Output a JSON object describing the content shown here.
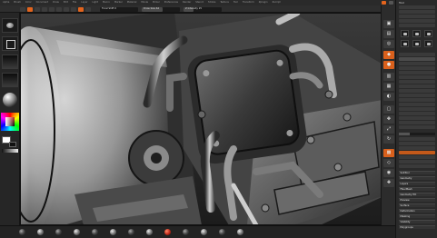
{
  "menubar": {
    "items": [
      "Alpha",
      "Brush",
      "Color",
      "Document",
      "Draw",
      "Edit",
      "File",
      "Layer",
      "Light",
      "Macro",
      "Marker",
      "Material",
      "Movie",
      "Picker",
      "Preferences",
      "Render",
      "Stencil",
      "Stroke",
      "Texture",
      "Tool",
      "Transform",
      "Zplugin",
      "Zscript"
    ],
    "accent": "#e3641d"
  },
  "toolbar": {
    "focal_shift": "Focal Shift 0",
    "draw_size": "Draw Size 64",
    "z_intensity": "Z Intensity 25",
    "focal_shift_level": 0.0,
    "draw_size_level": 0.55,
    "z_intensity_level": 0.25
  },
  "tool_palette": {
    "title": "Tool",
    "sections": [
      "SubTool",
      "Geometry",
      "Layers",
      "FiberMesh",
      "Geometry HD",
      "Preview",
      "Surface",
      "Deformation",
      "Masking",
      "Visibility",
      "Polygroups"
    ]
  },
  "colors": {
    "accent": "#e3641d",
    "main_color": "#ffffff",
    "secondary_color": "#111111"
  },
  "icons": {
    "left_shelf": [
      "brush-icon",
      "stroke-icon",
      "alpha-icon",
      "texture-icon",
      "material-icon",
      "color-picker-icon"
    ],
    "right_rail": [
      "bpr-icon",
      "scroll-icon",
      "zoom-icon",
      "actual-icon",
      "aahalf-icon",
      "persp-icon",
      "floor-icon",
      "local-icon",
      "frame-icon",
      "move-icon",
      "scale-icon",
      "rotate-icon",
      "polyframe-icon",
      "transp-icon",
      "solo-icon",
      "xpose-icon"
    ]
  }
}
